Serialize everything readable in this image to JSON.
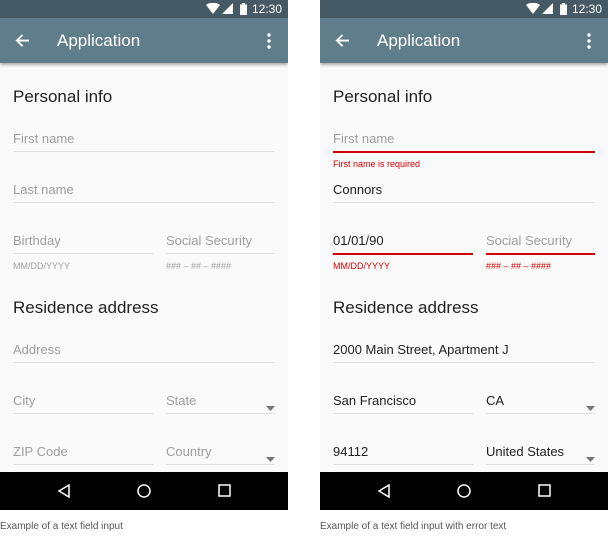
{
  "colors": {
    "status_bar": "#455a64",
    "toolbar": "#607d8b",
    "error": "#d50000"
  },
  "phones": [
    {
      "status_time": "12:30",
      "title": "Application",
      "sections": [
        "Personal info",
        "Residence address"
      ],
      "fields": [
        {
          "label": "First name",
          "value": "",
          "helper": "",
          "error": false
        },
        {
          "label": "Last name",
          "value": "",
          "helper": "",
          "error": false
        },
        {
          "label": "Birthday",
          "value": "",
          "helper": "MM/DD/YYYY",
          "error": false
        },
        {
          "label": "Social Security",
          "value": "",
          "helper": "### – ## – ####",
          "error": false
        },
        {
          "label": "Address",
          "value": "",
          "helper": "",
          "error": false
        },
        {
          "label": "City",
          "value": "",
          "helper": "",
          "error": false
        },
        {
          "label": "State",
          "value": "",
          "helper": "",
          "error": false,
          "dropdown": true
        },
        {
          "label": "ZIP Code",
          "value": "",
          "helper": "",
          "error": false
        },
        {
          "label": "Country",
          "value": "",
          "helper": "",
          "error": false,
          "dropdown": true
        }
      ],
      "caption": "Example of a text field input"
    },
    {
      "status_time": "12:30",
      "title": "Application",
      "sections": [
        "Personal info",
        "Residence address"
      ],
      "fields": [
        {
          "label": "First name",
          "value": "",
          "helper": "First name is required",
          "error": true
        },
        {
          "label": "Last name",
          "value": "Connors",
          "helper": "",
          "error": false
        },
        {
          "label": "Birthday",
          "value": "01/01/90",
          "helper": "MM/DD/YYYY",
          "error": true
        },
        {
          "label": "Social Security",
          "value": "",
          "helper": "### – ## – ####",
          "error": true
        },
        {
          "label": "Address",
          "value": "2000 Main Street, Apartment J",
          "helper": "",
          "error": false
        },
        {
          "label": "City",
          "value": "San Francisco",
          "helper": "",
          "error": false
        },
        {
          "label": "State",
          "value": "CA",
          "helper": "",
          "error": false,
          "dropdown": true
        },
        {
          "label": "ZIP Code",
          "value": "94112",
          "helper": "",
          "error": false
        },
        {
          "label": "Country",
          "value": "United States",
          "helper": "",
          "error": false,
          "dropdown": true
        }
      ],
      "caption": "Example of a text field input with error text"
    }
  ]
}
